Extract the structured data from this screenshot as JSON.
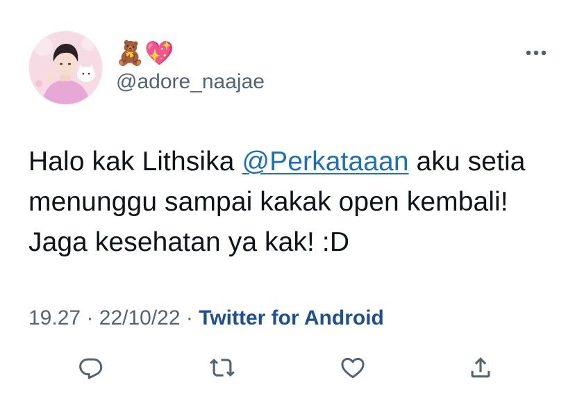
{
  "tweet": {
    "display_name_emojis": [
      "🧸",
      "💖"
    ],
    "handle": "@adore_naajae",
    "text_before": "Halo kak Lithsika ",
    "mention": "@Perkataaan",
    "text_after": " aku setia menunggu sampai kakak open kembali! Jaga kesehatan ya kak! :D",
    "time": "19.27",
    "separator": "·",
    "date": "22/10/22",
    "source": "Twitter for Android"
  },
  "icons": {
    "more": "more-horizontal-icon",
    "reply": "reply-icon",
    "retweet": "retweet-icon",
    "like": "heart-icon",
    "share": "share-icon"
  },
  "colors": {
    "text": "#0f1419",
    "secondary": "#536471",
    "mention": "#1d6fb8",
    "source": "#1d4f91",
    "avatar_bg": "#f6dbe4"
  }
}
